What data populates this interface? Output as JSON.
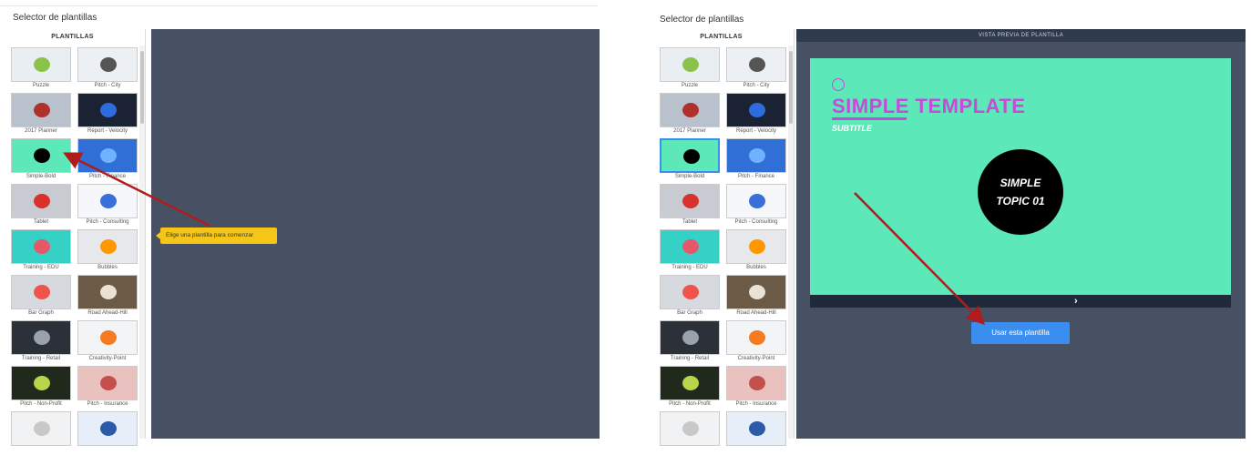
{
  "left_panel": {
    "title": "Selector de plantillas",
    "sidebar_header": "PLANTILLAS",
    "tooltip": "Elige una plantilla para comenzar"
  },
  "right_panel": {
    "title": "Selector de plantillas",
    "sidebar_header": "PLANTILLAS",
    "preview_header": "VISTA PREVIA DE PLANTILLA",
    "slide": {
      "title": "SIMPLE TEMPLATE",
      "subtitle": "SUBTITLE",
      "circle_line1": "SIMPLE",
      "circle_line2": "TOPIC 01"
    },
    "next_label": "›",
    "use_button": "Usar esta plantilla"
  },
  "templates": [
    {
      "label": "Puzzle",
      "color": "#e9eef3",
      "accent": "#8bc34a"
    },
    {
      "label": "Pitch - City",
      "color": "#eceff4",
      "accent": "#555555"
    },
    {
      "label": "2017 Planner",
      "color": "#b9c2cc",
      "accent": "#b0302c"
    },
    {
      "label": "Report - Velocity",
      "color": "#1b2233",
      "accent": "#2d6cdf"
    },
    {
      "label": "Simple-Bold",
      "color": "#5ce8b8",
      "accent": "#000000"
    },
    {
      "label": "Pitch - Finance",
      "color": "#2f6fd6",
      "accent": "#6fb2ff"
    },
    {
      "label": "Tablet",
      "color": "#c8ccd2",
      "accent": "#d9312b"
    },
    {
      "label": "Pitch - Consulting",
      "color": "#f5f7fb",
      "accent": "#3a6ed8"
    },
    {
      "label": "Training - EDU",
      "color": "#35d0c6",
      "accent": "#e6576a"
    },
    {
      "label": "Bubbles",
      "color": "#e6e8ec",
      "accent": "#ff9800"
    },
    {
      "label": "Bar Graph",
      "color": "#d6d9de",
      "accent": "#f0534a"
    },
    {
      "label": "Road Ahead-Hill",
      "color": "#6b5a45",
      "accent": "#e9e2d5"
    },
    {
      "label": "Training - Retail",
      "color": "#2c3038",
      "accent": "#9aa3ad"
    },
    {
      "label": "Creativity-Point",
      "color": "#f3f4f6",
      "accent": "#f47b20"
    },
    {
      "label": "Pitch - Non-Profit",
      "color": "#21291d",
      "accent": "#b8d64a"
    },
    {
      "label": "Pitch - Insurance",
      "color": "#e9c2c0",
      "accent": "#c4504b"
    },
    {
      "label": "",
      "color": "#f1f2f4",
      "accent": "#c8c8c8"
    },
    {
      "label": "",
      "color": "#e6eef8",
      "accent": "#2a5aa8"
    }
  ]
}
